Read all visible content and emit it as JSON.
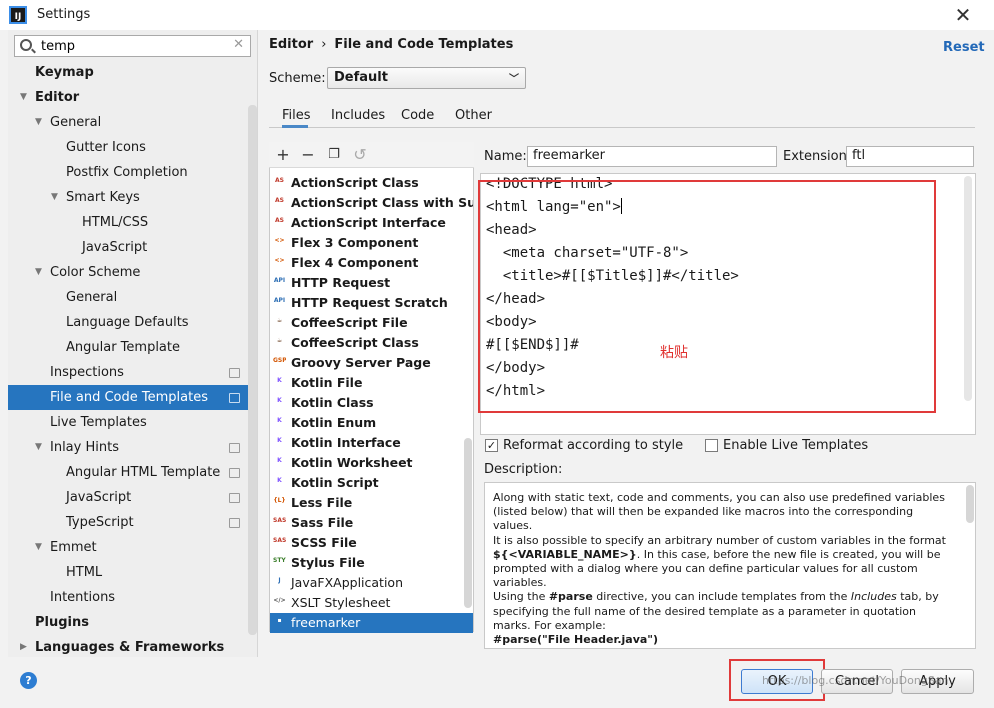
{
  "window": {
    "title": "Settings",
    "app_icon": "IJ"
  },
  "search": {
    "value": "temp"
  },
  "sidebar": {
    "items": [
      {
        "label": "Keymap",
        "bold": true
      },
      {
        "label": "Editor",
        "bold": true
      },
      {
        "label": "General"
      },
      {
        "label": "Gutter Icons"
      },
      {
        "label": "Postfix Completion"
      },
      {
        "label": "Smart Keys"
      },
      {
        "label": "HTML/CSS"
      },
      {
        "label": "JavaScript"
      },
      {
        "label": "Color Scheme"
      },
      {
        "label": "General"
      },
      {
        "label": "Language Defaults"
      },
      {
        "label": "Angular Template"
      },
      {
        "label": "Inspections"
      },
      {
        "label": "File and Code Templates",
        "selected": true
      },
      {
        "label": "Live Templates"
      },
      {
        "label": "Inlay Hints"
      },
      {
        "label": "Angular HTML Template"
      },
      {
        "label": "JavaScript"
      },
      {
        "label": "TypeScript"
      },
      {
        "label": "Emmet"
      },
      {
        "label": "HTML"
      },
      {
        "label": "Intentions"
      },
      {
        "label": "Plugins",
        "bold": true
      },
      {
        "label": "Languages & Frameworks",
        "bold": true
      }
    ]
  },
  "header": {
    "breadcrumb": [
      "Editor",
      "File and Code Templates"
    ],
    "reset_label": "Reset",
    "scheme_label": "Scheme:",
    "scheme_value": "Default"
  },
  "tabs": [
    "Files",
    "Includes",
    "Code",
    "Other"
  ],
  "templates": [
    {
      "label": "ActionScript Class",
      "icon": "AS",
      "icon_color": "#c0392b"
    },
    {
      "label": "ActionScript Class with Supers",
      "icon": "AS",
      "icon_color": "#c0392b"
    },
    {
      "label": "ActionScript Interface",
      "icon": "AS",
      "icon_color": "#c0392b"
    },
    {
      "label": "Flex 3 Component",
      "icon": "<>",
      "icon_color": "#d35400"
    },
    {
      "label": "Flex 4 Component",
      "icon": "<>",
      "icon_color": "#d35400"
    },
    {
      "label": "HTTP Request",
      "icon": "API",
      "icon_color": "#2e6fb5"
    },
    {
      "label": "HTTP Request Scratch",
      "icon": "API",
      "icon_color": "#2e6fb5"
    },
    {
      "label": "CoffeeScript File",
      "icon": "☕",
      "icon_color": "#6b4226"
    },
    {
      "label": "CoffeeScript Class",
      "icon": "☕",
      "icon_color": "#6b4226"
    },
    {
      "label": "Groovy Server Page",
      "icon": "GSP",
      "icon_color": "#d35400"
    },
    {
      "label": "Kotlin File",
      "icon": "K",
      "icon_color": "#7f52ff"
    },
    {
      "label": "Kotlin Class",
      "icon": "K",
      "icon_color": "#7f52ff"
    },
    {
      "label": "Kotlin Enum",
      "icon": "K",
      "icon_color": "#7f52ff"
    },
    {
      "label": "Kotlin Interface",
      "icon": "K",
      "icon_color": "#7f52ff"
    },
    {
      "label": "Kotlin Worksheet",
      "icon": "K",
      "icon_color": "#7f52ff"
    },
    {
      "label": "Kotlin Script",
      "icon": "K",
      "icon_color": "#7f52ff"
    },
    {
      "label": "Less File",
      "icon": "{L}",
      "icon_color": "#d35400"
    },
    {
      "label": "Sass File",
      "icon": "SASS",
      "icon_color": "#c0392b"
    },
    {
      "label": "SCSS File",
      "icon": "SASS",
      "icon_color": "#c0392b"
    },
    {
      "label": "Stylus File",
      "icon": "STYL",
      "icon_color": "#3a7d2a"
    },
    {
      "label": "JavaFXApplication",
      "icon": "J",
      "icon_color": "#2e6fb5"
    },
    {
      "label": "XSLT Stylesheet",
      "icon": "</>",
      "icon_color": "#555555"
    },
    {
      "label": "freemarker",
      "icon": "▪",
      "icon_color": "#2e6fb5",
      "selected": true
    }
  ],
  "form": {
    "name_label": "Name:",
    "name_value": "freemarker",
    "extension_label": "Extension:",
    "extension_value": "ftl"
  },
  "editor": {
    "lines": [
      "<!DOCTYPE html>",
      "<html lang=\"en\">",
      "<head>",
      "  <meta charset=\"UTF-8\">",
      "  <title>#[[$Title$]]#</title>",
      "</head>",
      "<body>",
      "#[[$END$]]#",
      "</body>",
      "</html>"
    ],
    "annotation": "粘贴"
  },
  "options": {
    "reformat_label": "Reformat according to style",
    "reformat_checked": true,
    "live_label": "Enable Live Templates",
    "live_checked": false
  },
  "description": {
    "label": "Description:",
    "p1": "Along with static text, code and comments, you can also use predefined variables (listed below) that will then be expanded like macros into the corresponding values.",
    "p2a": "It is also possible to specify an arbitrary number of custom variables in the format ",
    "p2code": "${<VARIABLE_NAME>}",
    "p2b": ". In this case, before the new file is created, you will be prompted with a dialog where you can define particular values for all custom variables.",
    "p3a": "Using the ",
    "p3code": "#parse",
    "p3b": " directive, you can include templates from the ",
    "p3em": "Includes",
    "p3c": " tab, by specifying the full name of the desired template as a parameter in quotation marks. For example:",
    "p4code": "#parse(\"File Header.java\")"
  },
  "buttons": {
    "ok": "OK",
    "cancel": "Cancel",
    "apply": "Apply"
  },
  "watermark": "https://blog.csdn.net/YouDongSan"
}
